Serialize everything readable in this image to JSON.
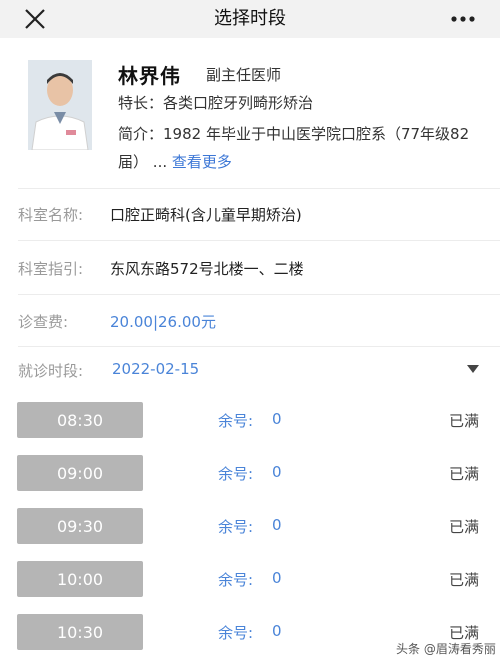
{
  "header": {
    "title": "选择时段",
    "close_icon": "close-icon",
    "more_icon": "more-horizontal-icon"
  },
  "doctor": {
    "name": "林界伟",
    "title": "副主任医师",
    "specialty_label": "特长：",
    "specialty": "各类口腔牙列畸形矫治",
    "intro_label": "简介：",
    "intro_text": "1982 年毕业于中山医学院口腔系（77年级82届）",
    "ellipsis": "...",
    "more_link": "查看更多"
  },
  "details": {
    "dept_label": "科室名称:",
    "dept_value": "口腔正畸科(含儿童早期矫治)",
    "guide_label": "科室指引:",
    "guide_value": "东风东路572号北楼一、二楼",
    "fee_label": "诊查费:",
    "fee_value": "20.00|26.00元",
    "date_label": "就诊时段:",
    "date_value": "2022-02-15"
  },
  "slots": [
    {
      "time": "08:30",
      "remain_label": "余号:",
      "remain": "0",
      "status": "已满"
    },
    {
      "time": "09:00",
      "remain_label": "余号:",
      "remain": "0",
      "status": "已满"
    },
    {
      "time": "09:30",
      "remain_label": "余号:",
      "remain": "0",
      "status": "已满"
    },
    {
      "time": "10:00",
      "remain_label": "余号:",
      "remain": "0",
      "status": "已满"
    },
    {
      "time": "10:30",
      "remain_label": "余号:",
      "remain": "0",
      "status": "已满"
    }
  ],
  "watermark": "头条 @眉涛看秀丽",
  "colors": {
    "accent": "#4a84d8",
    "slot_button": "#b5b5b5",
    "topbar": "#f2f2f2"
  }
}
